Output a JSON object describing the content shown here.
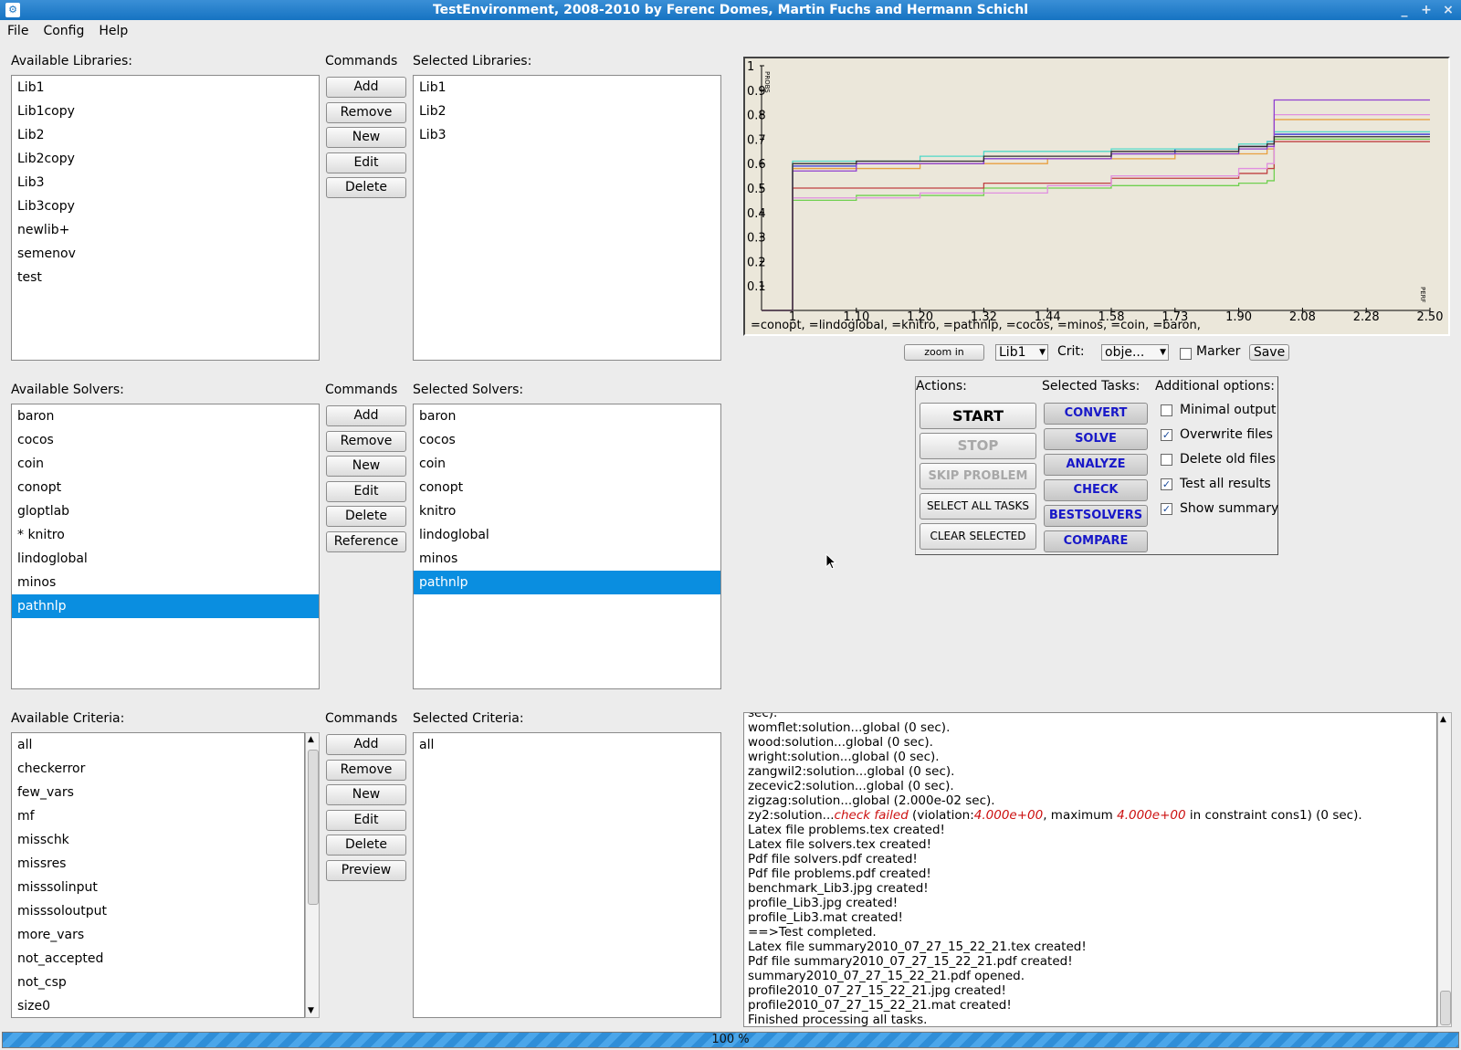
{
  "window": {
    "title": "TestEnvironment, 2008-2010 by Ferenc Domes, Martin Fuchs and Hermann Schichl",
    "controls": [
      "_",
      "+",
      "×"
    ]
  },
  "menu": [
    "File",
    "Config",
    "Help"
  ],
  "libraries": {
    "available_label": "Available Libraries:",
    "commands_label": "Commands",
    "selected_label": "Selected Libraries:",
    "available": [
      "Lib1",
      "Lib1copy",
      "Lib2",
      "Lib2copy",
      "Lib3",
      "Lib3copy",
      "newlib+",
      "semenov",
      "test"
    ],
    "selected": [
      "Lib1",
      "Lib2",
      "Lib3"
    ],
    "commands": [
      "Add",
      "Remove",
      "New",
      "Edit",
      "Delete"
    ]
  },
  "solvers": {
    "available_label": "Available Solvers:",
    "commands_label": "Commands",
    "selected_label": "Selected Solvers:",
    "available": [
      "baron",
      "cocos",
      "coin",
      "conopt",
      "gloptlab",
      "* knitro",
      "lindoglobal",
      "minos",
      "pathnlp"
    ],
    "available_selected_index": 8,
    "selected": [
      "baron",
      "cocos",
      "coin",
      "conopt",
      "knitro",
      "lindoglobal",
      "minos",
      "pathnlp"
    ],
    "selected_selected_index": 7,
    "commands": [
      "Add",
      "Remove",
      "New",
      "Edit",
      "Delete",
      "Reference"
    ]
  },
  "criteria": {
    "available_label": "Available Criteria:",
    "commands_label": "Commands",
    "selected_label": "Selected Criteria:",
    "available": [
      "all",
      "checkerror",
      "few_vars",
      "mf",
      "misschk",
      "missres",
      "misssolinput",
      "misssoloutput",
      "more_vars",
      "not_accepted",
      "not_csp",
      "size0"
    ],
    "selected": [
      "all"
    ],
    "commands": [
      "Add",
      "Remove",
      "New",
      "Edit",
      "Delete",
      "Preview"
    ]
  },
  "chart_data": {
    "type": "line",
    "ylabel": "PROBS",
    "xlabel": "PERF",
    "x_ticks": [
      "1",
      "1.10",
      "1.20",
      "1.32",
      "1.44",
      "1.58",
      "1.73",
      "1.90",
      "2.08",
      "2.28",
      "2.50"
    ],
    "y_ticks": [
      "0.1",
      "0.2",
      "0.3",
      "0.4",
      "0.5",
      "0.6",
      "0.7",
      "0.8",
      "0.9",
      "1"
    ],
    "ylim": [
      0,
      1
    ],
    "legend": "=conopt, =lindoglobal, =knitro, =pathnlp, =cocos, =minos, =coin, =baron,",
    "series": [
      {
        "name": "conopt",
        "color": "#3030d8",
        "points": [
          [
            0,
            0
          ],
          [
            1,
            0
          ],
          [
            1,
            0.59
          ],
          [
            1.1,
            0.6
          ],
          [
            1.32,
            0.62
          ],
          [
            1.58,
            0.64
          ],
          [
            1.73,
            0.66
          ],
          [
            1.9,
            0.67
          ],
          [
            1.98,
            0.69
          ],
          [
            2.0,
            0.72
          ],
          [
            2.5,
            0.72
          ]
        ]
      },
      {
        "name": "lindoglobal",
        "color": "#50d8c8",
        "points": [
          [
            0,
            0
          ],
          [
            1,
            0
          ],
          [
            1,
            0.61
          ],
          [
            1.2,
            0.63
          ],
          [
            1.32,
            0.65
          ],
          [
            1.58,
            0.66
          ],
          [
            1.9,
            0.68
          ],
          [
            1.98,
            0.69
          ],
          [
            2.0,
            0.73
          ],
          [
            2.5,
            0.73
          ]
        ]
      },
      {
        "name": "knitro",
        "color": "#70d050",
        "points": [
          [
            0,
            0
          ],
          [
            1,
            0
          ],
          [
            1,
            0.45
          ],
          [
            1.1,
            0.47
          ],
          [
            1.32,
            0.5
          ],
          [
            1.58,
            0.51
          ],
          [
            1.9,
            0.52
          ],
          [
            1.98,
            0.53
          ],
          [
            2.0,
            0.7
          ],
          [
            2.5,
            0.7
          ]
        ]
      },
      {
        "name": "pathnlp",
        "color": "#e8a040",
        "points": [
          [
            0,
            0
          ],
          [
            1,
            0
          ],
          [
            1,
            0.58
          ],
          [
            1.2,
            0.6
          ],
          [
            1.44,
            0.62
          ],
          [
            1.73,
            0.64
          ],
          [
            1.98,
            0.66
          ],
          [
            2.0,
            0.78
          ],
          [
            2.5,
            0.78
          ]
        ]
      },
      {
        "name": "cocos",
        "color": "#c04040",
        "points": [
          [
            0,
            0
          ],
          [
            1,
            0
          ],
          [
            1,
            0.5
          ],
          [
            1.1,
            0.5
          ],
          [
            1.32,
            0.52
          ],
          [
            1.58,
            0.54
          ],
          [
            1.9,
            0.56
          ],
          [
            1.98,
            0.58
          ],
          [
            2.0,
            0.69
          ],
          [
            2.5,
            0.69
          ]
        ]
      },
      {
        "name": "minos",
        "color": "#e090e0",
        "points": [
          [
            0,
            0
          ],
          [
            1,
            0
          ],
          [
            1,
            0.46
          ],
          [
            1.2,
            0.48
          ],
          [
            1.44,
            0.51
          ],
          [
            1.58,
            0.55
          ],
          [
            1.9,
            0.58
          ],
          [
            1.98,
            0.6
          ],
          [
            2.0,
            0.8
          ],
          [
            2.5,
            0.8
          ]
        ]
      },
      {
        "name": "coin",
        "color": "#9040d0",
        "points": [
          [
            0,
            0
          ],
          [
            1,
            0
          ],
          [
            1,
            0.57
          ],
          [
            1.1,
            0.6
          ],
          [
            1.32,
            0.62
          ],
          [
            1.58,
            0.64
          ],
          [
            1.9,
            0.66
          ],
          [
            1.98,
            0.67
          ],
          [
            2.0,
            0.86
          ],
          [
            2.5,
            0.86
          ]
        ]
      },
      {
        "name": "baron",
        "color": "#303030",
        "points": [
          [
            0,
            0
          ],
          [
            1,
            0
          ],
          [
            1,
            0.6
          ],
          [
            1.1,
            0.61
          ],
          [
            1.32,
            0.63
          ],
          [
            1.58,
            0.65
          ],
          [
            1.9,
            0.67
          ],
          [
            1.98,
            0.68
          ],
          [
            2.0,
            0.71
          ],
          [
            2.5,
            0.71
          ]
        ]
      }
    ]
  },
  "chart_controls": {
    "zoom_label": "zoom in",
    "library_value": "Lib1",
    "crit_label": "Crit:",
    "crit_value": "obje...",
    "marker_label": "Marker",
    "save_label": "Save"
  },
  "actions": {
    "label": "Actions:",
    "start": "START",
    "stop": "STOP",
    "skip": "SKIP PROBLEM",
    "select_all": "SELECT ALL TASKS",
    "clear_selected": "CLEAR SELECTED"
  },
  "tasks": {
    "label": "Selected Tasks:",
    "items": [
      "CONVERT",
      "SOLVE",
      "ANALYZE",
      "CHECK",
      "BESTSOLVERS",
      "COMPARE"
    ]
  },
  "options": {
    "label": "Additional options:",
    "items": [
      {
        "label": "Minimal output",
        "checked": false
      },
      {
        "label": "Overwrite files",
        "checked": true
      },
      {
        "label": "Delete old files",
        "checked": false
      },
      {
        "label": "Test all results",
        "checked": true
      },
      {
        "label": "Show summary",
        "checked": true
      }
    ]
  },
  "log": {
    "top_fragment": "sec).",
    "lines": [
      "womflet:solution...global (0 sec).",
      "wood:solution...global (0 sec).",
      "wright:solution...global (0 sec).",
      "zangwil2:solution...global (0 sec).",
      "zecevic2:solution...global (0 sec).",
      "zigzag:solution...global (2.000e-02 sec).",
      "__ZY2__",
      "Latex file problems.tex created!",
      "Latex file solvers.tex created!",
      "Pdf file solvers.pdf created!",
      "Pdf file problems.pdf created!",
      "benchmark_Lib3.jpg created!",
      "profile_Lib3.jpg created!",
      "profile_Lib3.mat created!",
      "==>Test completed.",
      "Latex file summary2010_07_27_15_22_21.tex created!",
      "Pdf file summary2010_07_27_15_22_21.pdf created!",
      "summary2010_07_27_15_22_21.pdf opened.",
      "profile2010_07_27_15_22_21.jpg created!",
      "profile2010_07_27_15_22_21.mat created!",
      "Finished processing all tasks."
    ],
    "zy2": {
      "prefix": "zy2:solution...",
      "status": "check failed",
      "mid1": " (violation:",
      "val1": "4.000e+00",
      "mid2": ", maximum ",
      "val2": "4.000e+00",
      "suffix": " in constraint cons1) (0 sec)."
    }
  },
  "progress": {
    "label": "100 %",
    "value": 1.0
  }
}
